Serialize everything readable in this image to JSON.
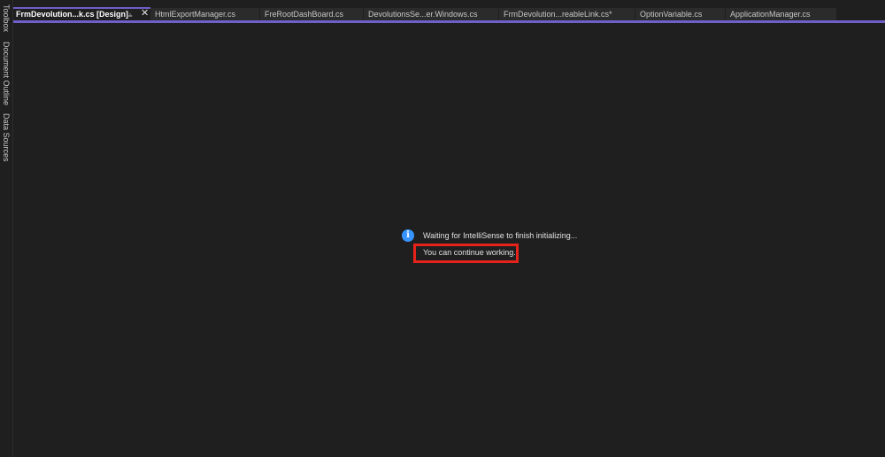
{
  "side_panel": {
    "items": [
      {
        "label": "Toolbox"
      },
      {
        "label": "Document Outline"
      },
      {
        "label": "Data Sources"
      }
    ]
  },
  "tabs": [
    {
      "label": "FrmDevolution...k.cs [Design]",
      "active": true
    },
    {
      "label": "HtmlExportManager.cs"
    },
    {
      "label": "FreRootDashBoard.cs"
    },
    {
      "label": "DevolutionsSe...er.Windows.cs"
    },
    {
      "label": "FrmDevolution...reableLink.cs*"
    },
    {
      "label": "OptionVariable.cs"
    },
    {
      "label": "ApplicationManager.cs"
    }
  ],
  "tab_icons": {
    "pin": "pin-icon",
    "close": "close-icon"
  },
  "message": {
    "icon": "info-icon",
    "line1": "Waiting for IntelliSense to finish initializing...",
    "line2": "You can continue working."
  },
  "colors": {
    "accent": "#6f5fc8",
    "info": "#3794ff",
    "highlight": "#e5231b",
    "background": "#1f1f1f"
  }
}
